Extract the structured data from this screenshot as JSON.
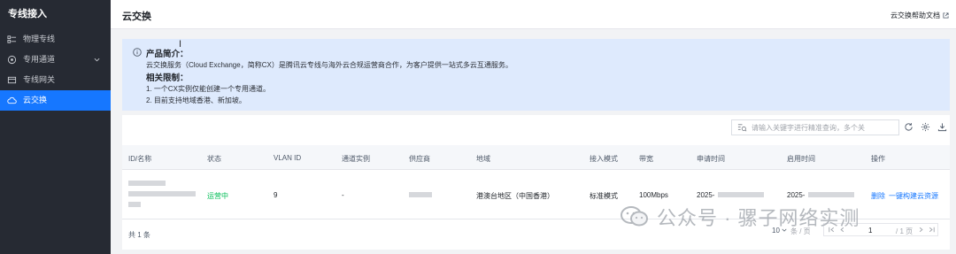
{
  "sidebar": {
    "title": "专线接入",
    "items": [
      {
        "label": "物理专线",
        "icon": "physical-line-icon"
      },
      {
        "label": "专用通道",
        "icon": "channel-icon"
      },
      {
        "label": "专线网关",
        "icon": "gateway-icon"
      },
      {
        "label": "云交换",
        "icon": "cloud-exchange-icon",
        "active": true
      }
    ]
  },
  "header": {
    "title": "云交换",
    "help_link": "云交换帮助文档"
  },
  "notice": {
    "intro_title": "产品简介：",
    "intro_text": "云交换服务（Cloud Exchange，简称CX）是腾讯云专线与海外云合规运营商合作，为客户提供一站式多云互通服务。",
    "limits_title": "相关限制：",
    "limits": [
      "1. 一个CX实例仅能创建一个专用通道。",
      "2. 目前支持地域香港、新加坡。"
    ]
  },
  "toolbar": {
    "search_placeholder": "请输入关键字进行精准查询，多个关",
    "icons": [
      "refresh-icon",
      "settings-icon",
      "download-icon"
    ]
  },
  "table": {
    "columns": [
      "ID/名称",
      "状态",
      "VLAN ID",
      "通道实例",
      "供应商",
      "地域",
      "接入模式",
      "带宽",
      "申请时间",
      "启用时间",
      "操作"
    ],
    "rows": [
      {
        "status": "运营中",
        "vlan": "9",
        "channel": "-",
        "region": "港澳台地区（中国香港）",
        "mode": "标准模式",
        "bandwidth": "100Mbps",
        "apply_time": "2025-",
        "enable_time": "2025-",
        "actions": [
          "删除",
          "一键构建云资源"
        ]
      }
    ]
  },
  "footer": {
    "total": "共 1 条",
    "page_size": "10",
    "page_size_unit": "条 / 页",
    "current_page": "1",
    "total_pages": "/ 1 页"
  },
  "watermark": {
    "text": "公众号 · 骡子网络实测"
  },
  "colors": {
    "sidebar_bg": "#262a33",
    "active": "#1677ff",
    "notice_bg": "#deeafd",
    "status_green": "#0abf5b"
  }
}
